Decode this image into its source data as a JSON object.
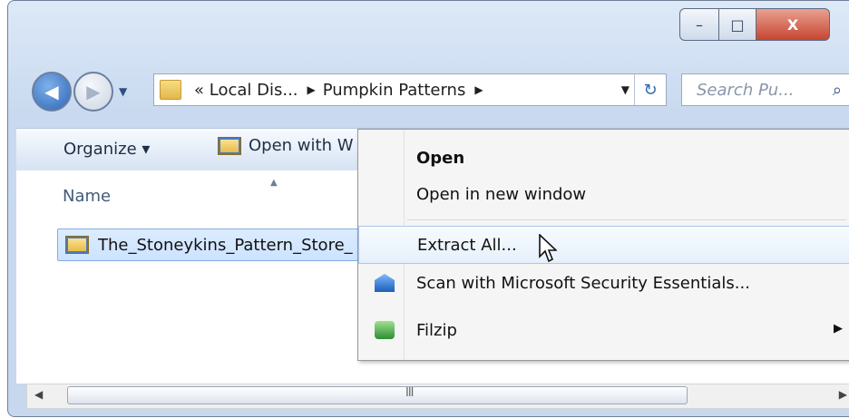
{
  "window": {
    "controls": [
      "–",
      "□",
      "X"
    ]
  },
  "nav": {
    "address_segments": [
      "« Local Dis...",
      "Pumpkin Patterns"
    ],
    "address_dropdown_icon": "chevron-down-icon",
    "refresh_icon": "refresh-icon",
    "search_placeholder": "Search Pu...",
    "search_icon": "search-icon"
  },
  "toolbar": {
    "organize_label": "Organize ▾",
    "open_with_label": "Open with W"
  },
  "content": {
    "column_header": "Name",
    "files": [
      "The_Stoneykins_Pattern_Store_"
    ]
  },
  "scrollbar": {
    "grip": "III"
  },
  "context_menu": {
    "items": [
      {
        "label": "Open",
        "icon": ""
      },
      {
        "label": "Open in new window",
        "icon": ""
      },
      {
        "label": "Extract All...",
        "icon": ""
      },
      {
        "label": "Scan with Microsoft Security Essentials...",
        "icon": "microsoft-security-essentials-icon"
      },
      {
        "label": "Filzip",
        "icon": "filzip-icon",
        "submenu": true
      }
    ]
  },
  "colors": {
    "window_gradient": "#dde9f7",
    "selection_fill": "#cce3ff",
    "menu_hover": "#e6f0fb",
    "close_button": "#c74532"
  }
}
